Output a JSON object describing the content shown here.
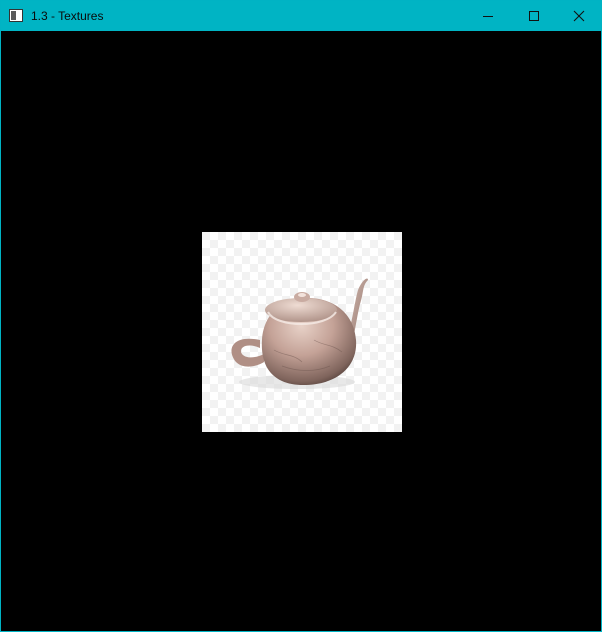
{
  "window": {
    "title": "1.3 - Textures",
    "accent_color": "#00b4c4",
    "background_color": "#000000"
  },
  "controls": {
    "minimize_icon": "minimize-icon",
    "maximize_icon": "maximize-icon",
    "close_icon": "close-icon"
  },
  "scene": {
    "object": "teapot",
    "texture_background": "checkerboard"
  }
}
